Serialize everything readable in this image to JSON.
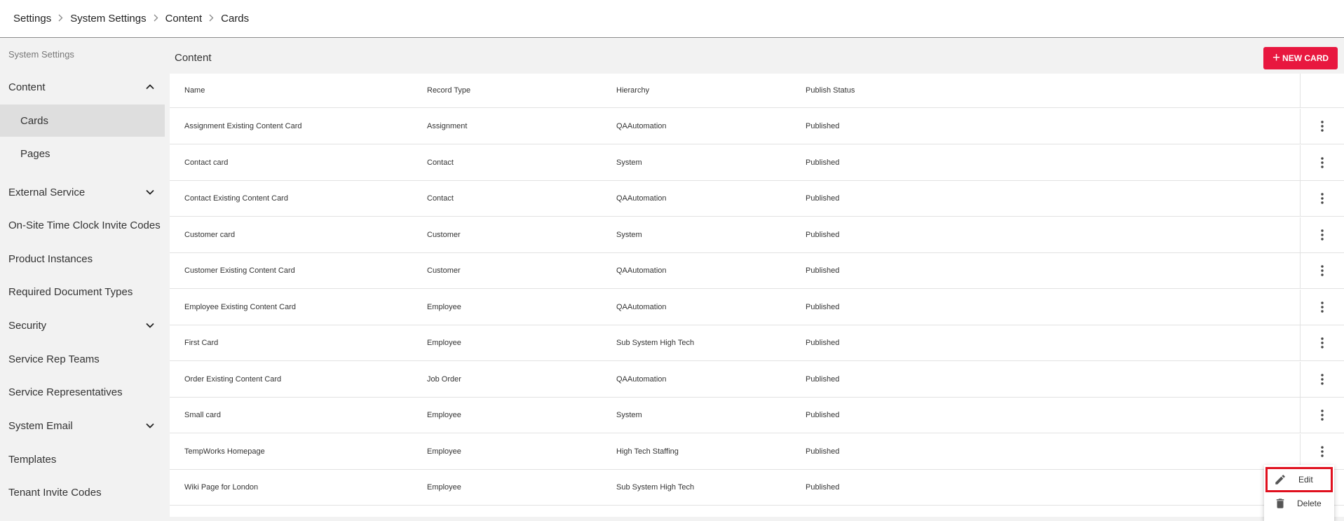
{
  "breadcrumb": [
    "Settings",
    "System Settings",
    "Content",
    "Cards"
  ],
  "sidebar": {
    "heading": "System Settings",
    "items": [
      {
        "label": "Content",
        "chevron": "up"
      },
      {
        "label": "Cards",
        "sub": true,
        "active": true
      },
      {
        "label": "Pages",
        "sub": true
      },
      {
        "label": "External Service",
        "chevron": "down"
      },
      {
        "label": "On-Site Time Clock Invite Codes"
      },
      {
        "label": "Product Instances"
      },
      {
        "label": "Required Document Types"
      },
      {
        "label": "Security",
        "chevron": "down"
      },
      {
        "label": "Service Rep Teams"
      },
      {
        "label": "Service Representatives"
      },
      {
        "label": "System Email",
        "chevron": "down"
      },
      {
        "label": "Templates"
      },
      {
        "label": "Tenant Invite Codes"
      }
    ]
  },
  "main": {
    "title": "Content",
    "new_card_label": "NEW CARD"
  },
  "table": {
    "columns": [
      "Name",
      "Record Type",
      "Hierarchy",
      "Publish Status"
    ],
    "rows": [
      [
        "Assignment Existing Content Card",
        "Assignment",
        "QAAutomation",
        "Published"
      ],
      [
        "Contact card",
        "Contact",
        "System",
        "Published"
      ],
      [
        "Contact Existing Content Card",
        "Contact",
        "QAAutomation",
        "Published"
      ],
      [
        "Customer card",
        "Customer",
        "System",
        "Published"
      ],
      [
        "Customer Existing Content Card",
        "Customer",
        "QAAutomation",
        "Published"
      ],
      [
        "Employee Existing Content Card",
        "Employee",
        "QAAutomation",
        "Published"
      ],
      [
        "First Card",
        "Employee",
        "Sub System High Tech",
        "Published"
      ],
      [
        "Order Existing Content Card",
        "Job Order",
        "QAAutomation",
        "Published"
      ],
      [
        "Small card",
        "Employee",
        "System",
        "Published"
      ],
      [
        "TempWorks Homepage",
        "Employee",
        "High Tech Staffing",
        "Published"
      ],
      [
        "Wiki Page for London",
        "Employee",
        "Sub System High Tech",
        "Published"
      ]
    ]
  },
  "context_menu": {
    "edit_label": "Edit",
    "delete_label": "Delete"
  },
  "colors": {
    "accent": "#e8173f",
    "highlight": "#e0101e"
  }
}
